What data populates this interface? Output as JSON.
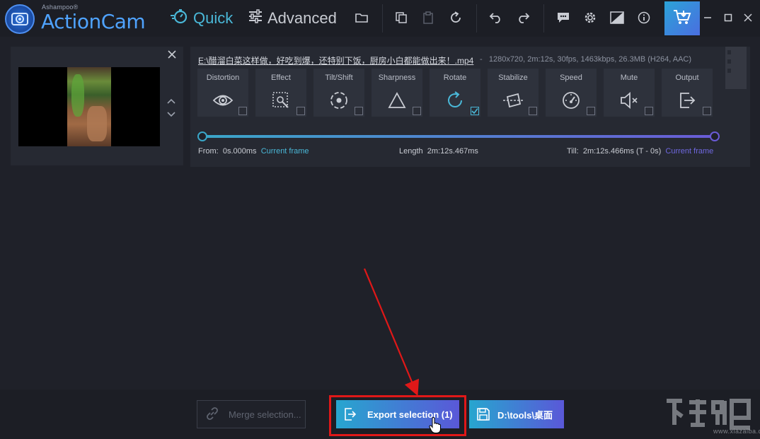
{
  "app": {
    "brand_small": "Ashampoo®",
    "brand_name": "ActionCam",
    "accent": "#4ab8d8",
    "brand_color": "#4fa3ff"
  },
  "nav": {
    "quick_label": "Quick",
    "advanced_label": "Advanced"
  },
  "toolbar_icons": [
    "folder-icon",
    "copy-icon",
    "clipboard-icon",
    "reset-icon",
    "undo-icon",
    "redo-icon",
    "feedback-icon",
    "gear-icon",
    "compare-icon",
    "info-icon",
    "cart-icon",
    "minimize-icon",
    "maximize-icon",
    "close-icon"
  ],
  "clip": {
    "filename": "E:\\醋溜白菜这样做，好吃到爆，还特别下饭，厨房小白都能做出来！.mp4",
    "separator": "-",
    "fileinfo": "1280x720, 2m:12s, 30fps, 1463kbps, 26.3MB (H264, AAC)",
    "tools": [
      {
        "label": "Distortion",
        "icon": "eye-icon",
        "checked": false
      },
      {
        "label": "Effect",
        "icon": "effect-icon",
        "checked": false
      },
      {
        "label": "Tilt/Shift",
        "icon": "tiltshift-icon",
        "checked": false
      },
      {
        "label": "Sharpness",
        "icon": "triangle-icon",
        "checked": false
      },
      {
        "label": "Rotate",
        "icon": "rotate-icon",
        "checked": true
      },
      {
        "label": "Stabilize",
        "icon": "stabilize-icon",
        "checked": false
      },
      {
        "label": "Speed",
        "icon": "speedometer-icon",
        "checked": false
      },
      {
        "label": "Mute",
        "icon": "mute-icon",
        "checked": false
      },
      {
        "label": "Output",
        "icon": "output-icon",
        "checked": false
      }
    ],
    "from_label": "From:",
    "from_value": "0s.000ms",
    "current_frame": "Current frame",
    "length_label": "Length",
    "length_value": "2m:12s.467ms",
    "till_label": "Till:",
    "till_value": "2m:12s.466ms (T - 0s)"
  },
  "bottom": {
    "merge_label": "Merge selection...",
    "export_label": "Export selection (1)",
    "path_label": "D:\\tools\\桌面"
  },
  "watermark": {
    "text": "www.xiazaiba.com"
  }
}
